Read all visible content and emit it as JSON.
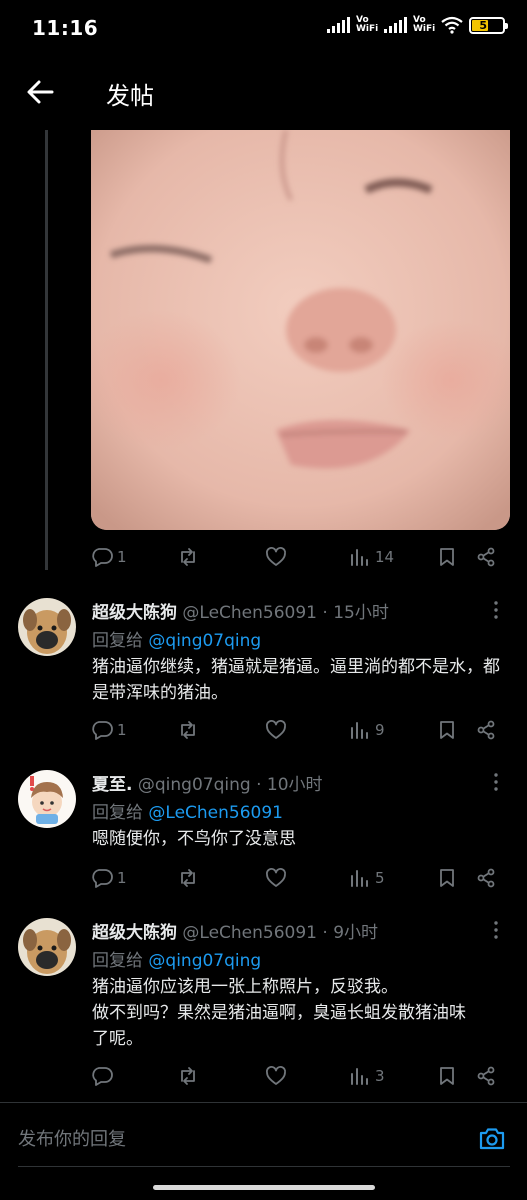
{
  "status_bar": {
    "time": "11:16",
    "network_1": "Vo WiFi",
    "network_2": "Vo WiFi",
    "battery": "51"
  },
  "header": {
    "title": "发帖",
    "back_icon": "arrow-left-icon"
  },
  "post": {
    "image_icon": "photo-icon",
    "actions": {
      "replies": "1",
      "retweets": "",
      "likes": "",
      "views": "14"
    }
  },
  "replies": [
    {
      "name": "超级大陈狗",
      "handle_time": "@LeChen56091 · 15小时",
      "reply_to_prefix": "回复给 ",
      "reply_to": "@qing07qing",
      "text": "猪油逼你继续，猪逼就是猪逼。逼里淌的都不是水，都是带浑味的猪油。",
      "actions": {
        "replies": "1",
        "retweets": "",
        "likes": "",
        "views": "9"
      }
    },
    {
      "name": "夏至.",
      "handle_time": "@qing07qing · 10小时",
      "reply_to_prefix": "回复给 ",
      "reply_to": "@LeChen56091",
      "text": "嗯随便你，不鸟你了没意思",
      "actions": {
        "replies": "1",
        "retweets": "",
        "likes": "",
        "views": "5"
      }
    },
    {
      "name": "超级大陈狗",
      "handle_time": "@LeChen56091 · 9小时",
      "reply_to_prefix": "回复给 ",
      "reply_to": "@qing07qing",
      "text_lines": [
        "猪油逼你应该甩一张上称照片，反驳我。",
        "做不到吗？果然是猪油逼啊，臭逼长蛆发散猪油味",
        "了呢。"
      ],
      "actions": {
        "replies": "",
        "retweets": "",
        "likes": "",
        "views": "3"
      }
    }
  ],
  "composer": {
    "placeholder": "发布你的回复"
  },
  "colors": {
    "background": "#000000",
    "accent": "#1d9bf0",
    "muted": "#71767b",
    "text": "#e7e9ea"
  }
}
